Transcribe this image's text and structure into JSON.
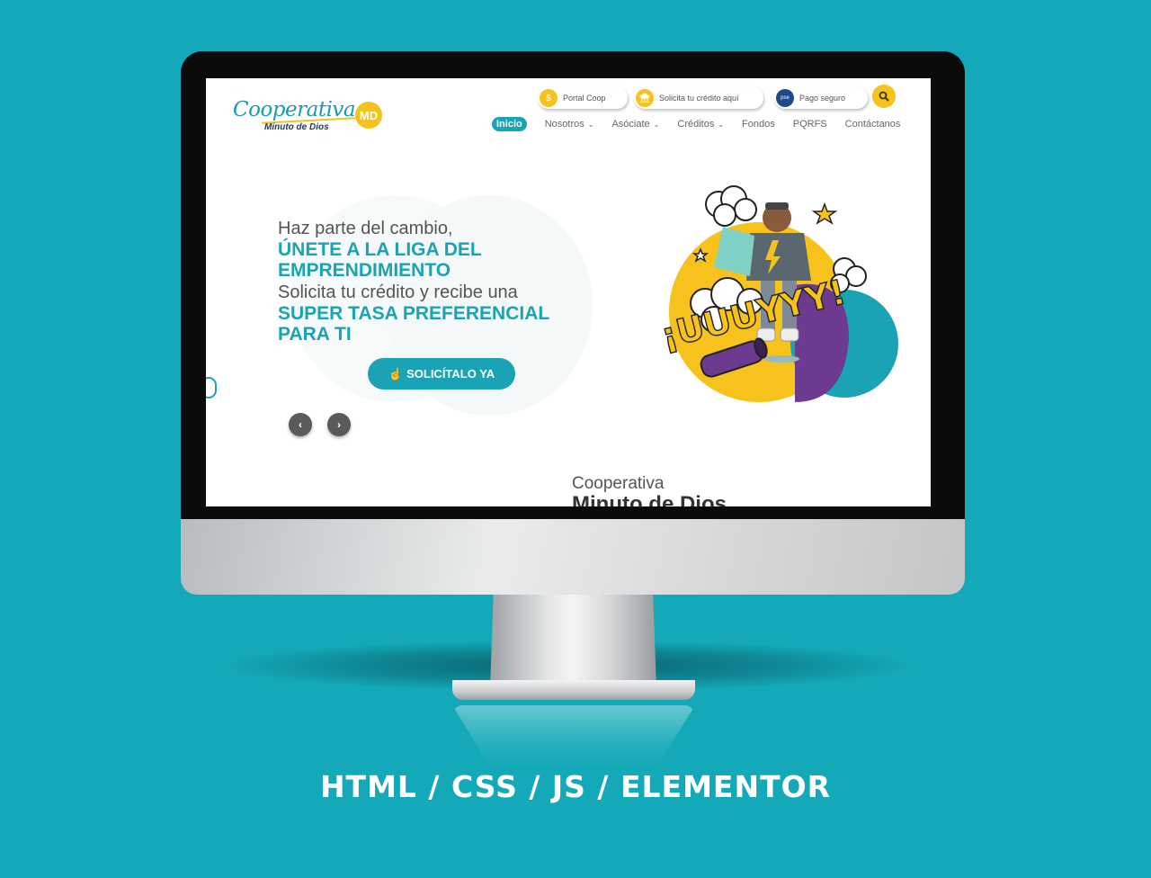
{
  "header": {
    "logo": {
      "script": "Cooperativa",
      "sub": "Minuto de Dios",
      "badge": "MD"
    },
    "quick_links": [
      {
        "label": "Portal Coop",
        "icon": "coin-icon"
      },
      {
        "label": "Solicita tu crédito aquí",
        "icon": "bank-icon"
      },
      {
        "label": "Pago seguro",
        "icon": "pse-icon",
        "icon_text": "pse"
      }
    ],
    "search_icon": "search-icon",
    "nav": [
      {
        "label": "Inicio",
        "active": true
      },
      {
        "label": "Nosotros",
        "dropdown": true
      },
      {
        "label": "Asóciate",
        "dropdown": true
      },
      {
        "label": "Créditos",
        "dropdown": true
      },
      {
        "label": "Fondos"
      },
      {
        "label": "PQRFS"
      },
      {
        "label": "Contáctanos"
      }
    ]
  },
  "hero": {
    "line1": "Haz parte del cambio,",
    "line2a": "ÚNETE A LA LIGA DEL",
    "line2b": "EMPRENDIMIENTO",
    "line3": "Solicita tu crédito y recibe una",
    "line4a": "SUPER TASA PREFERENCIAL",
    "line4b": "PARA TI",
    "cta": "SOLICÍTALO YA",
    "art_text": "¡UUUYYY!",
    "colors": {
      "accent": "#1aa3b4",
      "yellow": "#f6c21b",
      "purple": "#6c3a8e"
    }
  },
  "section": {
    "line1": "Cooperativa",
    "line2": "Minuto de Dios"
  },
  "caption": "HTML  / CSS / JS / ELEMENTOR"
}
